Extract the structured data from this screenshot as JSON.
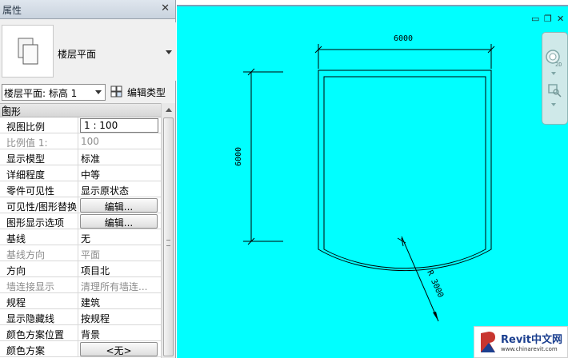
{
  "properties": {
    "title": "属性",
    "close_glyph": "✕",
    "type_selector": {
      "name": "楼层平面"
    },
    "filter": {
      "value": "楼层平面: 标高 1"
    },
    "edit_type_label": "编辑类型",
    "section": {
      "label": "图形",
      "collapse_glyph": "⌃"
    },
    "rows": [
      {
        "key": "视图比例",
        "value": "1 : 100"
      },
      {
        "key": "比例值 1:",
        "value": "100"
      },
      {
        "key": "显示模型",
        "value": "标准"
      },
      {
        "key": "详细程度",
        "value": "中等"
      },
      {
        "key": "零件可见性",
        "value": "显示原状态"
      },
      {
        "key": "可见性/图形替换",
        "value": "编辑..."
      },
      {
        "key": "图形显示选项",
        "value": "编辑..."
      },
      {
        "key": "基线",
        "value": "无"
      },
      {
        "key": "基线方向",
        "value": "平面"
      },
      {
        "key": "方向",
        "value": "项目北"
      },
      {
        "key": "墙连接显示",
        "value": "清理所有墙连..."
      },
      {
        "key": "规程",
        "value": "建筑"
      },
      {
        "key": "显示隐藏线",
        "value": "按规程"
      },
      {
        "key": "颜色方案位置",
        "value": "背景"
      },
      {
        "key": "颜色方案",
        "value": "<无>"
      }
    ]
  },
  "drawing": {
    "dim_width": "6000",
    "dim_height": "6000",
    "dim_radius": "R 3000",
    "background_color": "#00ffff"
  },
  "window_controls": {
    "minimize": "▭",
    "restore": "❐",
    "close": "✕"
  },
  "navbar": {
    "icons": [
      "steering-wheel-icon",
      "zoom-icon"
    ]
  },
  "watermark": {
    "brand": "Revit中文网",
    "url": "www.chinarevit.com"
  }
}
